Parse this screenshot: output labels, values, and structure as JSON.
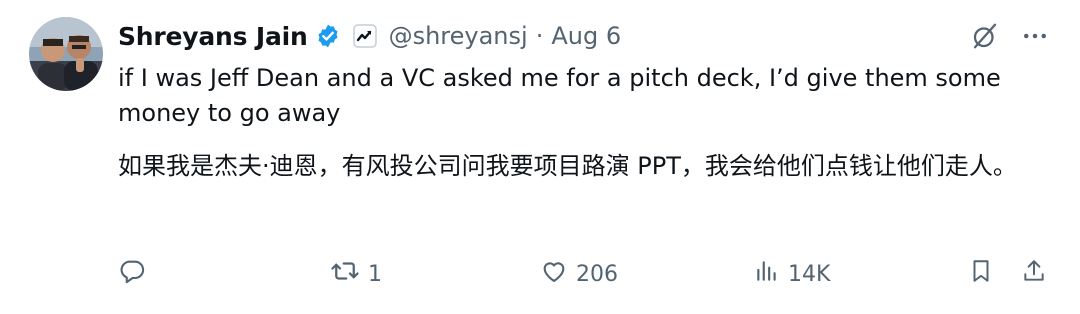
{
  "tweet": {
    "author": {
      "display_name": "Shreyans Jain",
      "handle": "@shreyansj",
      "verified": true,
      "verified_color": "#1d9bf0"
    },
    "separator": "·",
    "date": "Aug 6",
    "text_en": "if I was Jeff Dean and a VC asked me for a pitch deck, I’d give them some money to go away",
    "text_zh": "如果我是杰夫·迪恩，有风投公司问我要项目路演 PPT，我会给他们点钱让他们走人。",
    "metrics": {
      "replies": "",
      "retweets": "1",
      "likes": "206",
      "views": "14K"
    },
    "icons": {
      "verified": "verified-badge-icon",
      "affiliate": "affiliate-badge-icon",
      "grok": "grok-icon",
      "more": "more-icon",
      "reply": "reply-icon",
      "retweet": "retweet-icon",
      "like": "heart-icon",
      "views": "views-icon",
      "bookmark": "bookmark-icon",
      "share": "share-icon"
    },
    "colors": {
      "text_primary": "#0f1419",
      "text_secondary": "#536471",
      "accent": "#1d9bf0"
    }
  }
}
